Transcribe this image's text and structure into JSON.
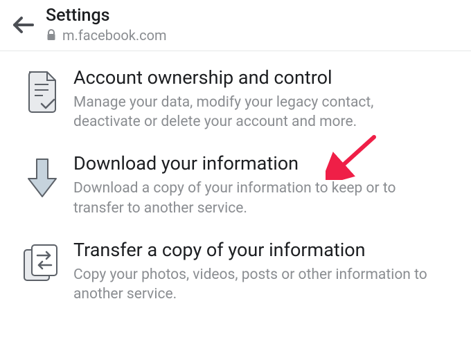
{
  "header": {
    "title": "Settings",
    "url": "m.facebook.com"
  },
  "items": [
    {
      "title": "Account ownership and control",
      "desc": "Manage your data, modify your legacy contact, deactivate or delete your account and more."
    },
    {
      "title": "Download your information",
      "desc": "Download a copy of your information to keep or to transfer to another service."
    },
    {
      "title": "Transfer a copy of your information",
      "desc": "Copy your photos, videos, posts or other information to another service."
    }
  ],
  "annotation": {
    "color": "#ef1f47"
  }
}
